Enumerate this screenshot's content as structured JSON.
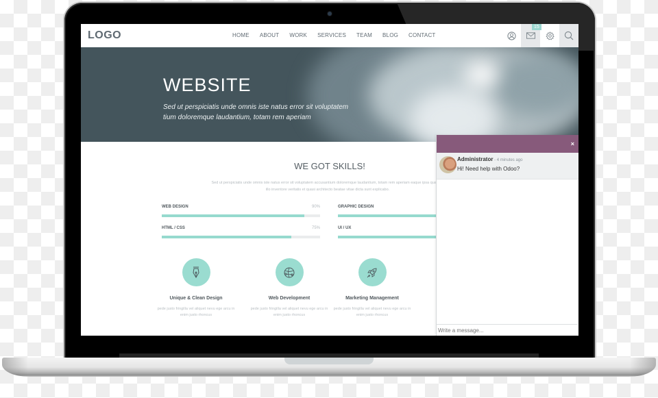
{
  "device": "laptop",
  "navbar": {
    "logo": "LOGO",
    "links": [
      "HOME",
      "ABOUT",
      "WORK",
      "SERVICES",
      "TEAM",
      "BLOG",
      "CONTACT"
    ],
    "icons": [
      "user-icon",
      "mail-icon",
      "gear-icon",
      "search-icon"
    ],
    "mail_badge": "15"
  },
  "hero": {
    "title": "WEBSITE",
    "subtitle": "Sed ut perspiciatis unde omnis iste natus error sit voluptatem tium doloremque laudantium, totam rem aperiam"
  },
  "skills": {
    "title": "WE GOT SKILLS!",
    "description": "Sed ut perspiciatis unde omnis iste natus error sit voluptatem accusantium doloremque laudantium, totam rem aperiam eaque ipsa quae ab illo inventore veritatis et quasi architecto beatae vitae dicta sunt explicabo.",
    "items": [
      {
        "label": "WEB DESIGN",
        "percent": "90%",
        "value": 0.9
      },
      {
        "label": "HTML / CSS",
        "percent": "75%",
        "value": 0.82
      },
      {
        "label": "GRAPHIC DESIGN",
        "percent": "",
        "value": 1.0
      },
      {
        "label": "UI / UX",
        "percent": "",
        "value": 1.0
      }
    ]
  },
  "features": [
    {
      "icon": "pen-nib-icon",
      "title": "Unique & Clean Design",
      "text": "pede justo fringilla vel aliquet nevu ege arcu in enim justo rhoncus"
    },
    {
      "icon": "globe-icon",
      "title": "Web Development",
      "text": "pede justo fringilla vel aliquet nevu ege arcu in enim justo rhoncus"
    },
    {
      "icon": "rocket-icon",
      "title": "Marketing Management",
      "text": "pede justo fringilla vel aliquet nevu ege arcu in enim justo rhoncus"
    }
  ],
  "chat": {
    "close_label": "×",
    "message": {
      "author": "Administrator",
      "time": " - 4 minutes ago",
      "text": "Hi! Need help with Odoo?"
    },
    "input_placeholder": "Write a message..."
  },
  "colors": {
    "accent": "#9adcd0",
    "chat_header": "#875a7b",
    "hero_bg": "#44555c"
  }
}
